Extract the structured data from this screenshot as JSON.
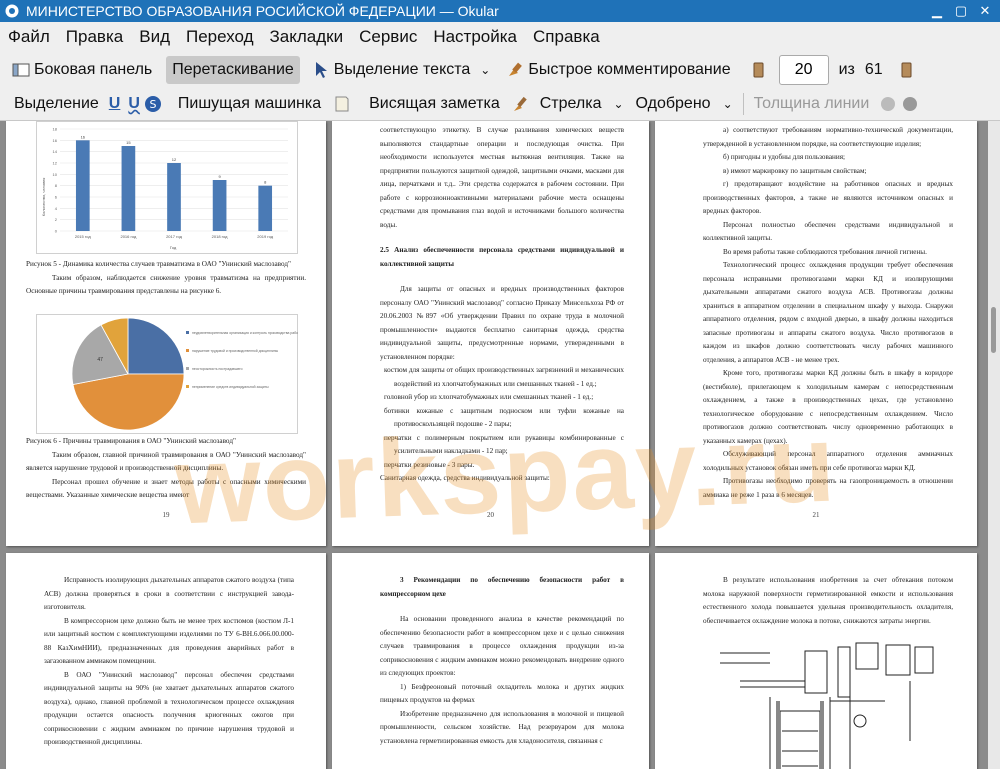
{
  "window": {
    "title": "МИНИСТЕРСТВО ОБРАЗОВАНИЯ РОСИЙСКОЙ ФЕДЕРАЦИИ  — Okular"
  },
  "menu": [
    "Файл",
    "Правка",
    "Вид",
    "Переход",
    "Закладки",
    "Сервис",
    "Настройка",
    "Справка"
  ],
  "toolbar1": {
    "sidebar": "Боковая панель",
    "drag": "Перетаскивание",
    "text_select": "Выделение текста",
    "quick_comment": "Быстрое комментирование",
    "page_value": "20",
    "of_label": "из",
    "total_pages": "61"
  },
  "toolbar2": {
    "highlight": "Выделение",
    "typewriter": "Пишущая машинка",
    "note": "Висящая заметка",
    "arrow": "Стрелка",
    "approved": "Одобрено",
    "line_width": "Толщина линии"
  },
  "watermark": "workspay.ru",
  "pages": {
    "p19": {
      "number": "19",
      "fig5_caption": "Рисунок 5 - Динамика количества случаев травматизма в ОАО \"Унинский маслозавод\"",
      "para1": "Таким образом, наблюдается снижение уровня травматизма на предприятии. Основные причины травмирования представлены на рисунке 6.",
      "fig6_caption": "Рисунок 6 - Причины травмирования в ОАО \"Унинский маслозавод\"",
      "para2": "Таким образом, главной причиной травмирования в ОАО \"Унинский маслозавод\" является нарушение трудовой и производственной дисциплины.",
      "para3": "Персонал прошел обучение и знает методы работы с опасными химическими веществами. Указанные химические вещества имеют"
    },
    "p20": {
      "number": "20",
      "para1": "соответствующую этикетку. В случае разливания химических веществ выполняются стандартные операции и последующая очистка. При необходимости используется местная вытяжная вентиляция. Также на предприятии пользуются защитной одеждой, защитными очками, масками для лица, перчатками и т.д.. Эти средства содержатся в рабочем состоянии. При работе с коррозионноактивными материалами рабочие места оснащены средствами для промывания глаз водой и источниками большого количества воды.",
      "heading": "2.5 Анализ обеспеченности персонала средствами индивидуальной и коллективной защиты",
      "para2": "Для защиты от опасных и вредных производственных факторов персоналу ОАО \"Унинский маслозавод\" согласно Приказу Минсельхоза РФ от 20.06.2003 №897 «Об утверждении Правил по охране труда в молочной промышленности» выдаются бесплатно санитарная одежда, средства индивидуальной защиты, предусмотренные нормами, утвержденными в установленном порядке:",
      "items": [
        "костюм для защиты от общих производственных загрязнений и механических воздействий из хлопчатобумажных или смешанных тканей - 1 ед.;",
        "головной убор из хлопчатобумажных или смешанных тканей - 1 ед.;",
        "ботинки кожаные с защитным подноском или туфли кожаные на противоскользящей подошве - 2 пары;",
        "перчатки с полимерным покрытием или рукавицы комбинированные с усилительными накладками - 12 пар;",
        "перчатки резиновые - 3 пары."
      ],
      "para3": "Санитарная одежда, средства индивидуальной защиты:"
    },
    "p21": {
      "number": "21",
      "items": [
        "а) соответствуют требованиям нормативно-технической документации, утвержденной в установленном порядке, на соответствующие изделия;",
        "б) пригодны и удобны для пользования;",
        "в) имеют маркировку по защитным свойствам;",
        "г) предотвращают воздействие на работников опасных и вредных производственных факторов, а также не являются источником опасных и вредных факторов."
      ],
      "para1": "Персонал полностью обеспечен средствами индивидуальной и коллективной защиты.",
      "para2": "Во время работы также соблюдаются требования личной гигиены.",
      "para3": "Технологический процесс охлаждения продукции требует обеспечения персонала исправными противогазами марки КД и изолирующими дыхательными аппаратами сжатого воздуха АСВ. Противогазы должны храниться в аппаратном отделении в специальном шкафу у выхода. Снаружи аппаратного отделения, рядом с входной дверью, в шкафу должны находиться запасные противогазы и аппараты сжатого воздуха. Число противогазов в каждом из шкафов должно соответствовать числу рабочих машинного отделения, а аппаратов АСВ - не менее трех.",
      "para4": "Кроме того, противогазы марки КД должны быть в шкафу в коридоре (вестибюле), прилегающем к холодильным камерам с непосредственным охлаждением, а также в производственных цехах, где установлено технологическое оборудование с непосредственным охлаждением. Число противогазов должно соответствовать числу одновременно работающих в указанных камерах (цехах).",
      "para5": "Обслуживающий персонал аппаратного отделения аммиачных холодильных установок обязан иметь при себе противогаз марки КД.",
      "para6": "Противогазы необходимо проверять на газопроницаемость в отношении аммиака не реже 1 раза в 6 месяцев."
    },
    "p22": {
      "para1": "Исправность изолирующих дыхательных аппаратов сжатого воздуха (типа АСВ) должна проверяться в сроки в соответствии с инструкцией завода-изготовителя.",
      "para2": "В компрессорном цехе должно быть не менее трех костюмов (костюм Л-1 или защитный костюм с комплектующими изделиями по ТУ 6-ВН.6.066.00.000-88 КазХимНИИ), предназначенных для проведения аварийных работ в загазованном аммиаком помещении.",
      "para3": "В ОАО \"Унинский маслозавод\" персонал обеспечен средствами индивидуальной защиты на 90% (не хватает дыхательных аппаратов сжатого воздуха), однако, главной проблемой в технологическом процессе охлаждения продукции остается опасность получения криогенных ожогов при соприкосновении с жидким аммиаком по причине нарушения трудовой и производственной дисциплины."
    },
    "p23": {
      "heading": "3 Рекомендации по обеспечению безопасности работ в компрессорном цехе",
      "para1": "На основании проведенного анализа в качестве рекомендаций по обеспечению безопасности работ в компрессорном цехе и с целью снижения случаев травмирования в процессе охлаждения продукции из-за соприкосновения с жидким аммиаком можно рекомендовать внедрение одного из следующих проектов:",
      "para2": "1) Безфреоновый поточный охладитель молока и других жидких пищевых продуктов на фермах",
      "para3": "Изобретение предназначено для использования в молочной и пищевой промышленности, сельском хозяйстве. Над резервуаром для молока установлена герметизированная емкость для хладоносителя, связанная с"
    },
    "p24": {
      "para1": "В результате использования изобретения за счет обтекания потоком молока наружной поверхности герметизированной емкости и использования естественного холода повышается удельная производительность охладителя, обеспечивается охлаждение молока в потоке, снижаются затраты энергии."
    }
  },
  "chart_data": [
    {
      "type": "bar",
      "categories": [
        "2015 год",
        "2016 год",
        "2017 год",
        "2018 год",
        "2019 год"
      ],
      "values": [
        16,
        15,
        12,
        9,
        8
      ],
      "ylim": [
        0,
        18
      ],
      "yticks": [
        0,
        2,
        4,
        6,
        8,
        10,
        12,
        14,
        16,
        18
      ],
      "ylabel": "Количество, человек",
      "xlabel": "Год",
      "colors": {
        "bar": "#4a7ab5"
      }
    },
    {
      "type": "pie",
      "categories": [
        "неудовлетворительная организация и контроль производства работ",
        "нарушение трудовой и производственной дисциплины",
        "неосторожность пострадавшего",
        "неприменение средств индивидуальной защиты"
      ],
      "values": [
        25,
        47,
        20,
        8
      ],
      "data_labels": [
        "",
        "",
        "47",
        ""
      ],
      "colors": [
        "#4a6fa5",
        "#e1903b",
        "#a8a8a8",
        "#e1a33b"
      ]
    }
  ]
}
